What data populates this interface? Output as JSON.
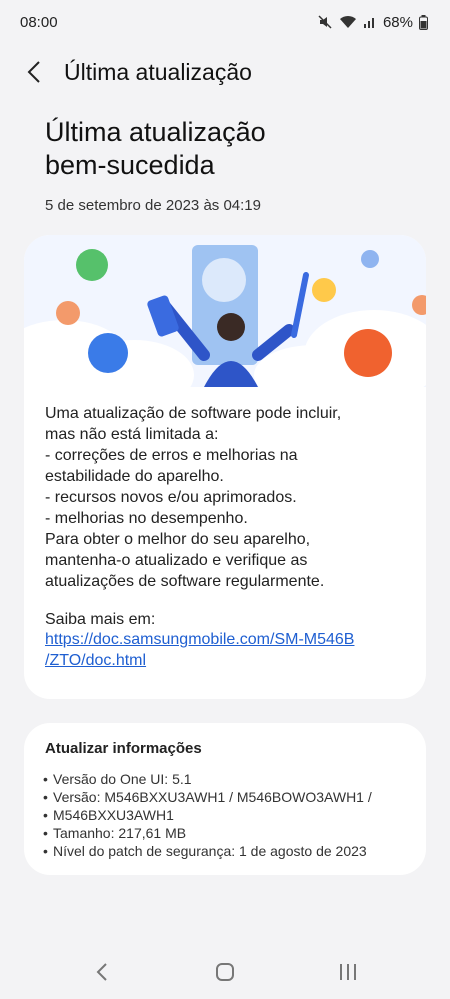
{
  "status_bar": {
    "time": "08:00",
    "battery": "68%",
    "icons": [
      "mute-icon",
      "wifi-icon",
      "signal-icon",
      "battery-icon"
    ]
  },
  "app_bar": {
    "title": "Última atualização"
  },
  "hero": {
    "title_line1": "Última atualização",
    "title_line2": "bem-sucedida",
    "date": "5 de setembro de 2023 às 04:19"
  },
  "info_card": {
    "lines": [
      "Uma atualização de software pode incluir,",
      "mas não está limitada a:",
      " - correções de erros e melhorias na",
      "estabilidade do aparelho.",
      " - recursos novos e/ou aprimorados.",
      " - melhorias no desempenho.",
      "Para obter o melhor do seu aparelho,",
      "mantenha-o atualizado e verifique as",
      "atualizações de software regularmente."
    ],
    "learn_more": "Saiba mais em:",
    "link_line1": "https://doc.samsungmobile.com/SM-M546B",
    "link_line2": "/ZTO/doc.html"
  },
  "update_info": {
    "heading": "Atualizar informações",
    "items": [
      "Versão do One UI: 5.1",
      "Versão: M546BXXU3AWH1 / M546BOWO3AWH1 /",
      "M546BXXU3AWH1",
      "Tamanho: 217,61 MB",
      "Nível do patch de segurança: 1 de agosto de 2023"
    ]
  },
  "colors": {
    "background": "#f3f3f5",
    "card": "#ffffff",
    "link": "#1f5fd1"
  }
}
